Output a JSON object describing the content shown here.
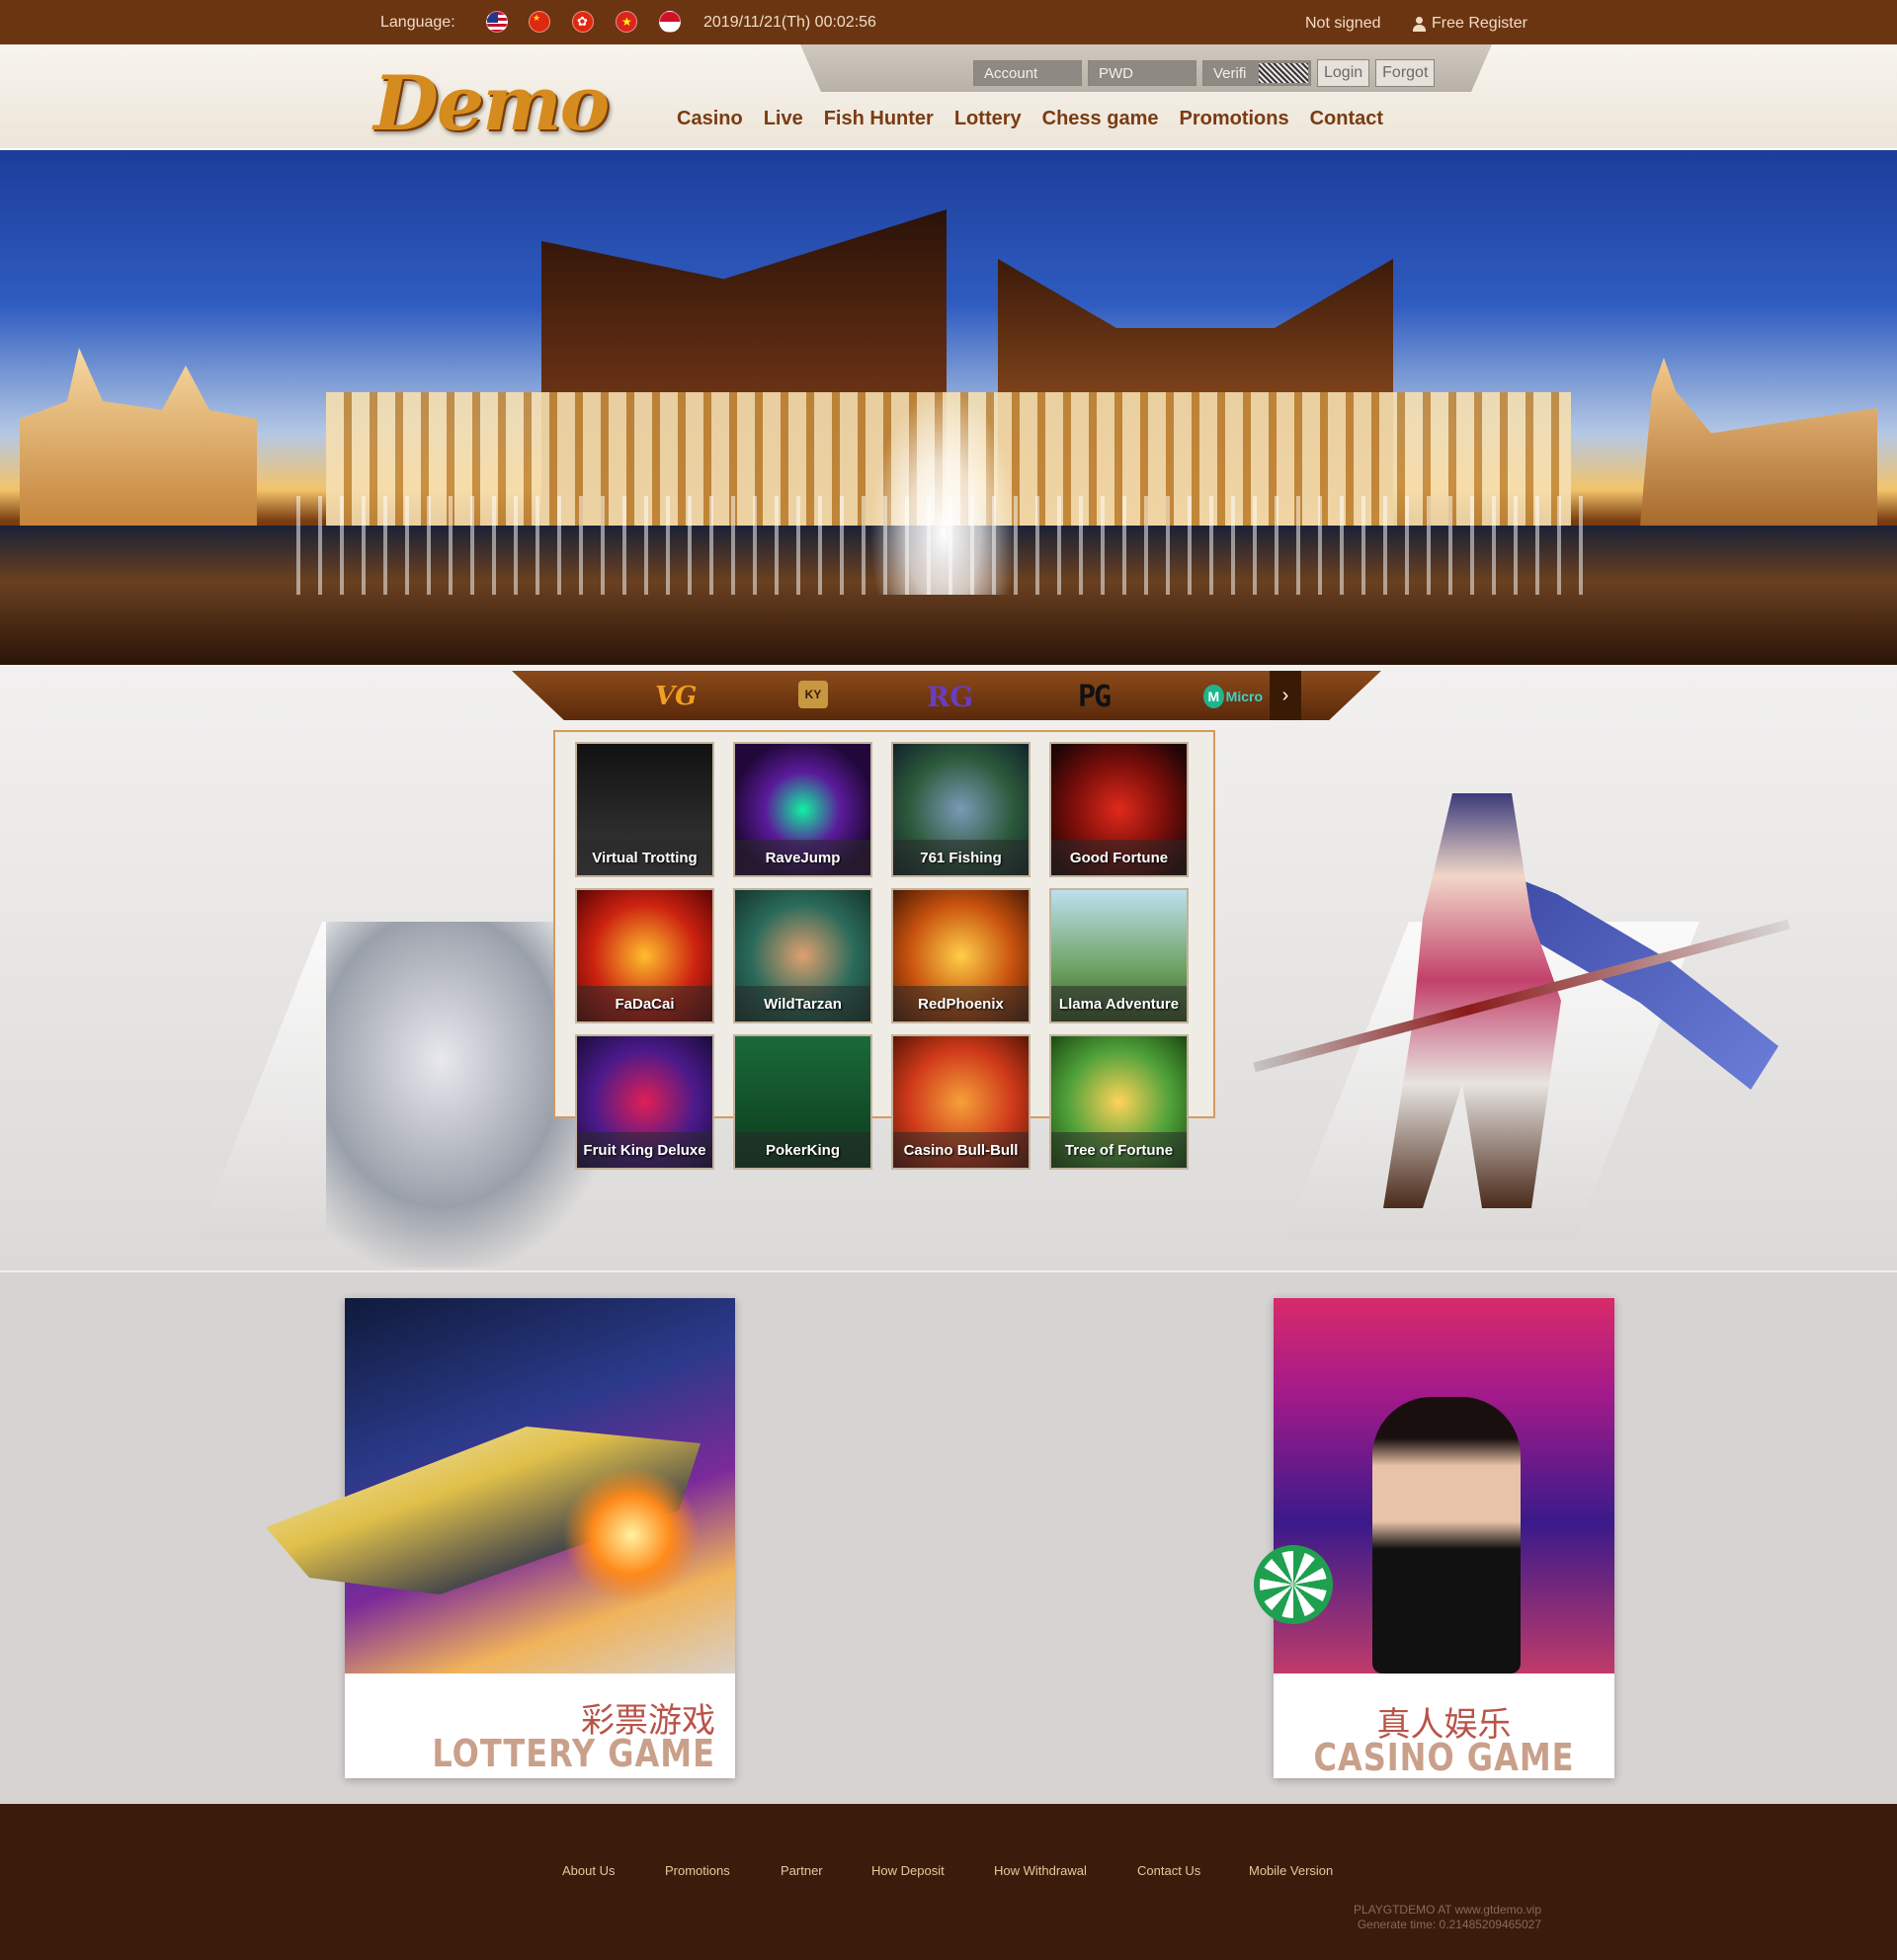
{
  "topbar": {
    "language_label": "Language:",
    "flags": [
      "us-flag-icon",
      "china-flag-icon",
      "hongkong-flag-icon",
      "vietnam-flag-icon",
      "indonesia-flag-icon"
    ],
    "datetime": "2019/11/21(Th) 00:02:56",
    "status": "Not signed",
    "register_label": "Free Register"
  },
  "header": {
    "logo": "Demo",
    "login": {
      "account_placeholder": "Account",
      "pwd_placeholder": "PWD",
      "verif_placeholder": "Verifi",
      "login_label": "Login",
      "forgot_label": "Forgot"
    },
    "nav": [
      "Casino",
      "Live",
      "Fish Hunter",
      "Lottery",
      "Chess game",
      "Promotions",
      "Contact"
    ]
  },
  "providers": {
    "items": [
      "VG",
      "KY",
      "RG",
      "PG",
      "Micro"
    ],
    "next_icon": "chevron-right-icon"
  },
  "games": [
    "Virtual Trotting",
    "RaveJump",
    "761 Fishing",
    "Good Fortune",
    "FaDaCai",
    "WildTarzan",
    "RedPhoenix",
    "Llama Adventure",
    "Fruit King Deluxe",
    "PokerKing",
    "Casino Bull-Bull",
    "Tree of Fortune"
  ],
  "promos": {
    "lottery": {
      "cn": "彩票游戏",
      "en": "LOTTERY GAME"
    },
    "casino": {
      "cn": "真人娱乐",
      "en": "CASINO GAME"
    }
  },
  "footer": {
    "links": [
      "About Us",
      "Promotions",
      "Partner",
      "How Deposit",
      "How Withdrawal",
      "Contact Us",
      "Mobile Version"
    ],
    "site": "PLAYGTDEMO AT www.gtdemo.vip",
    "generate": "Generate time: 0.21485209465027"
  },
  "colors": {
    "topbar": "#6b3512",
    "nav_text": "#7b3b12",
    "footer": "#3b1b0b",
    "accent": "#d68b1f"
  }
}
